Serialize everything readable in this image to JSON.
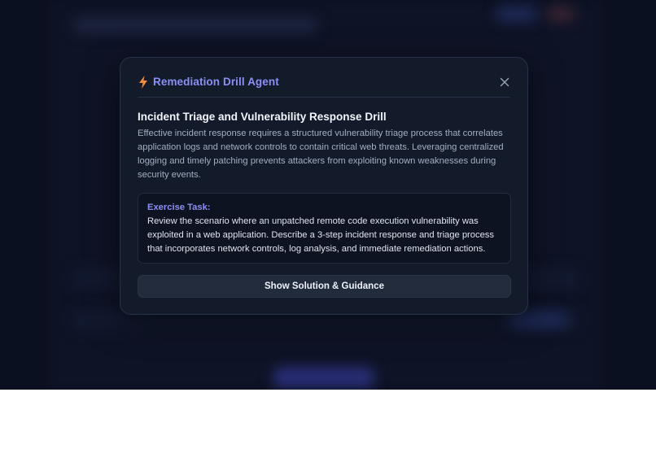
{
  "modal": {
    "title": "Remediation Drill Agent",
    "title_icon": "bolt-icon",
    "close_icon": "close-icon",
    "section_title": "Incident Triage and Vulnerability Response Drill",
    "section_body": "Effective incident response requires a structured vulnerability triage process that correlates application logs and network controls to contain critical web threats. Leveraging centralized logging and timely patching prevents attackers from exploiting known weaknesses during security events.",
    "task": {
      "label": "Exercise Task:",
      "text": "Review the scenario where an unpatched remote code execution vulnerability was exploited in a web application. Describe a 3-step incident response and triage process that incorporates network controls, log analysis, and immediate remediation actions."
    },
    "solution_button_label": "Show Solution & Guidance"
  },
  "colors": {
    "accent": "#8b8ff5",
    "bolt": "#f08a3c",
    "modal_bg": "#131b2b",
    "backdrop": "#0b1020"
  }
}
